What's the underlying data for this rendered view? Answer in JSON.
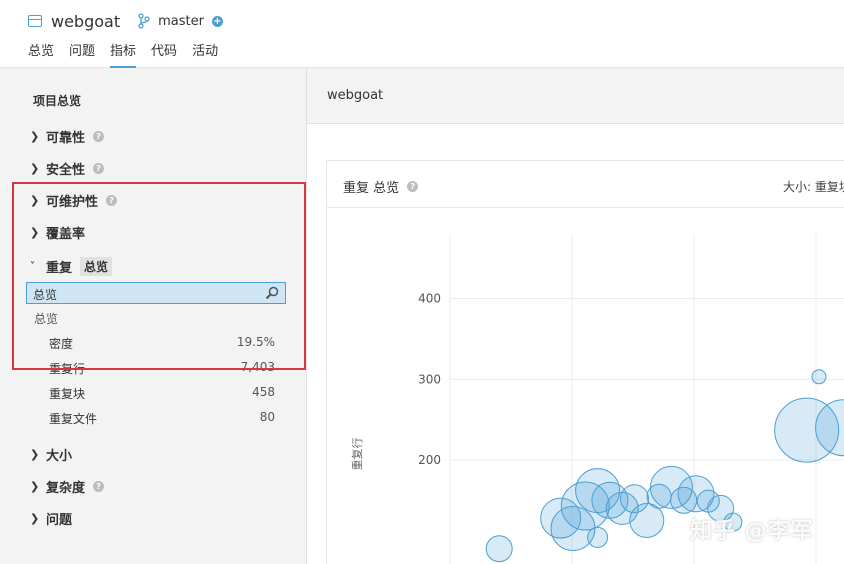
{
  "header": {
    "project_name": "webgoat",
    "branch": "master",
    "project_icon": "folder-icon",
    "branch_icon": "branch-icon",
    "add_icon": "plus-circle-icon",
    "tabs": [
      {
        "label": "总览",
        "active": false
      },
      {
        "label": "问题",
        "active": false
      },
      {
        "label": "指标",
        "active": true
      },
      {
        "label": "代码",
        "active": false
      },
      {
        "label": "活动",
        "active": false
      }
    ]
  },
  "sidebar": {
    "title": "项目总览",
    "items_top": [
      {
        "label": "可靠性",
        "help": true
      },
      {
        "label": "安全性",
        "help": true
      },
      {
        "label": "可维护性",
        "help": true
      },
      {
        "label": "覆盖率",
        "help": false
      }
    ],
    "duplication": {
      "label": "重复",
      "badge": "总览",
      "search_value": "总览",
      "group_label": "总览",
      "metrics": [
        {
          "name": "密度",
          "value": "19.5%"
        },
        {
          "name": "重复行",
          "value": "7,403"
        },
        {
          "name": "重复块",
          "value": "458"
        },
        {
          "name": "重复文件",
          "value": "80"
        }
      ]
    },
    "items_bottom": [
      {
        "label": "大小",
        "help": false
      },
      {
        "label": "复杂度",
        "help": true
      },
      {
        "label": "问题",
        "help": false
      }
    ]
  },
  "main": {
    "title": "webgoat",
    "card": {
      "title": "重复 总览",
      "size_label": "大小: 重复块"
    }
  },
  "chart_data": {
    "type": "scatter",
    "ylabel": "重复行",
    "y_ticks": [
      200,
      300,
      400
    ],
    "grid": true,
    "color": "#4b9fd5",
    "points": [
      {
        "x": 0.4,
        "y": 303,
        "r": 7
      },
      {
        "x": 0.39,
        "y": 237,
        "r": 32
      },
      {
        "x": 0.42,
        "y": 240,
        "r": 28
      },
      {
        "x": 0.22,
        "y": 162,
        "r": 22
      },
      {
        "x": 0.21,
        "y": 143,
        "r": 24
      },
      {
        "x": 0.19,
        "y": 128,
        "r": 20
      },
      {
        "x": 0.2,
        "y": 115,
        "r": 22
      },
      {
        "x": 0.23,
        "y": 150,
        "r": 18
      },
      {
        "x": 0.24,
        "y": 140,
        "r": 16
      },
      {
        "x": 0.25,
        "y": 152,
        "r": 14
      },
      {
        "x": 0.26,
        "y": 125,
        "r": 17
      },
      {
        "x": 0.27,
        "y": 155,
        "r": 12
      },
      {
        "x": 0.28,
        "y": 166,
        "r": 21
      },
      {
        "x": 0.29,
        "y": 150,
        "r": 13
      },
      {
        "x": 0.3,
        "y": 158,
        "r": 18
      },
      {
        "x": 0.31,
        "y": 149,
        "r": 11
      },
      {
        "x": 0.32,
        "y": 140,
        "r": 13
      },
      {
        "x": 0.33,
        "y": 123,
        "r": 9
      },
      {
        "x": 0.14,
        "y": 90,
        "r": 13
      },
      {
        "x": 0.22,
        "y": 104,
        "r": 10
      }
    ]
  },
  "watermark": "知乎 @李军"
}
